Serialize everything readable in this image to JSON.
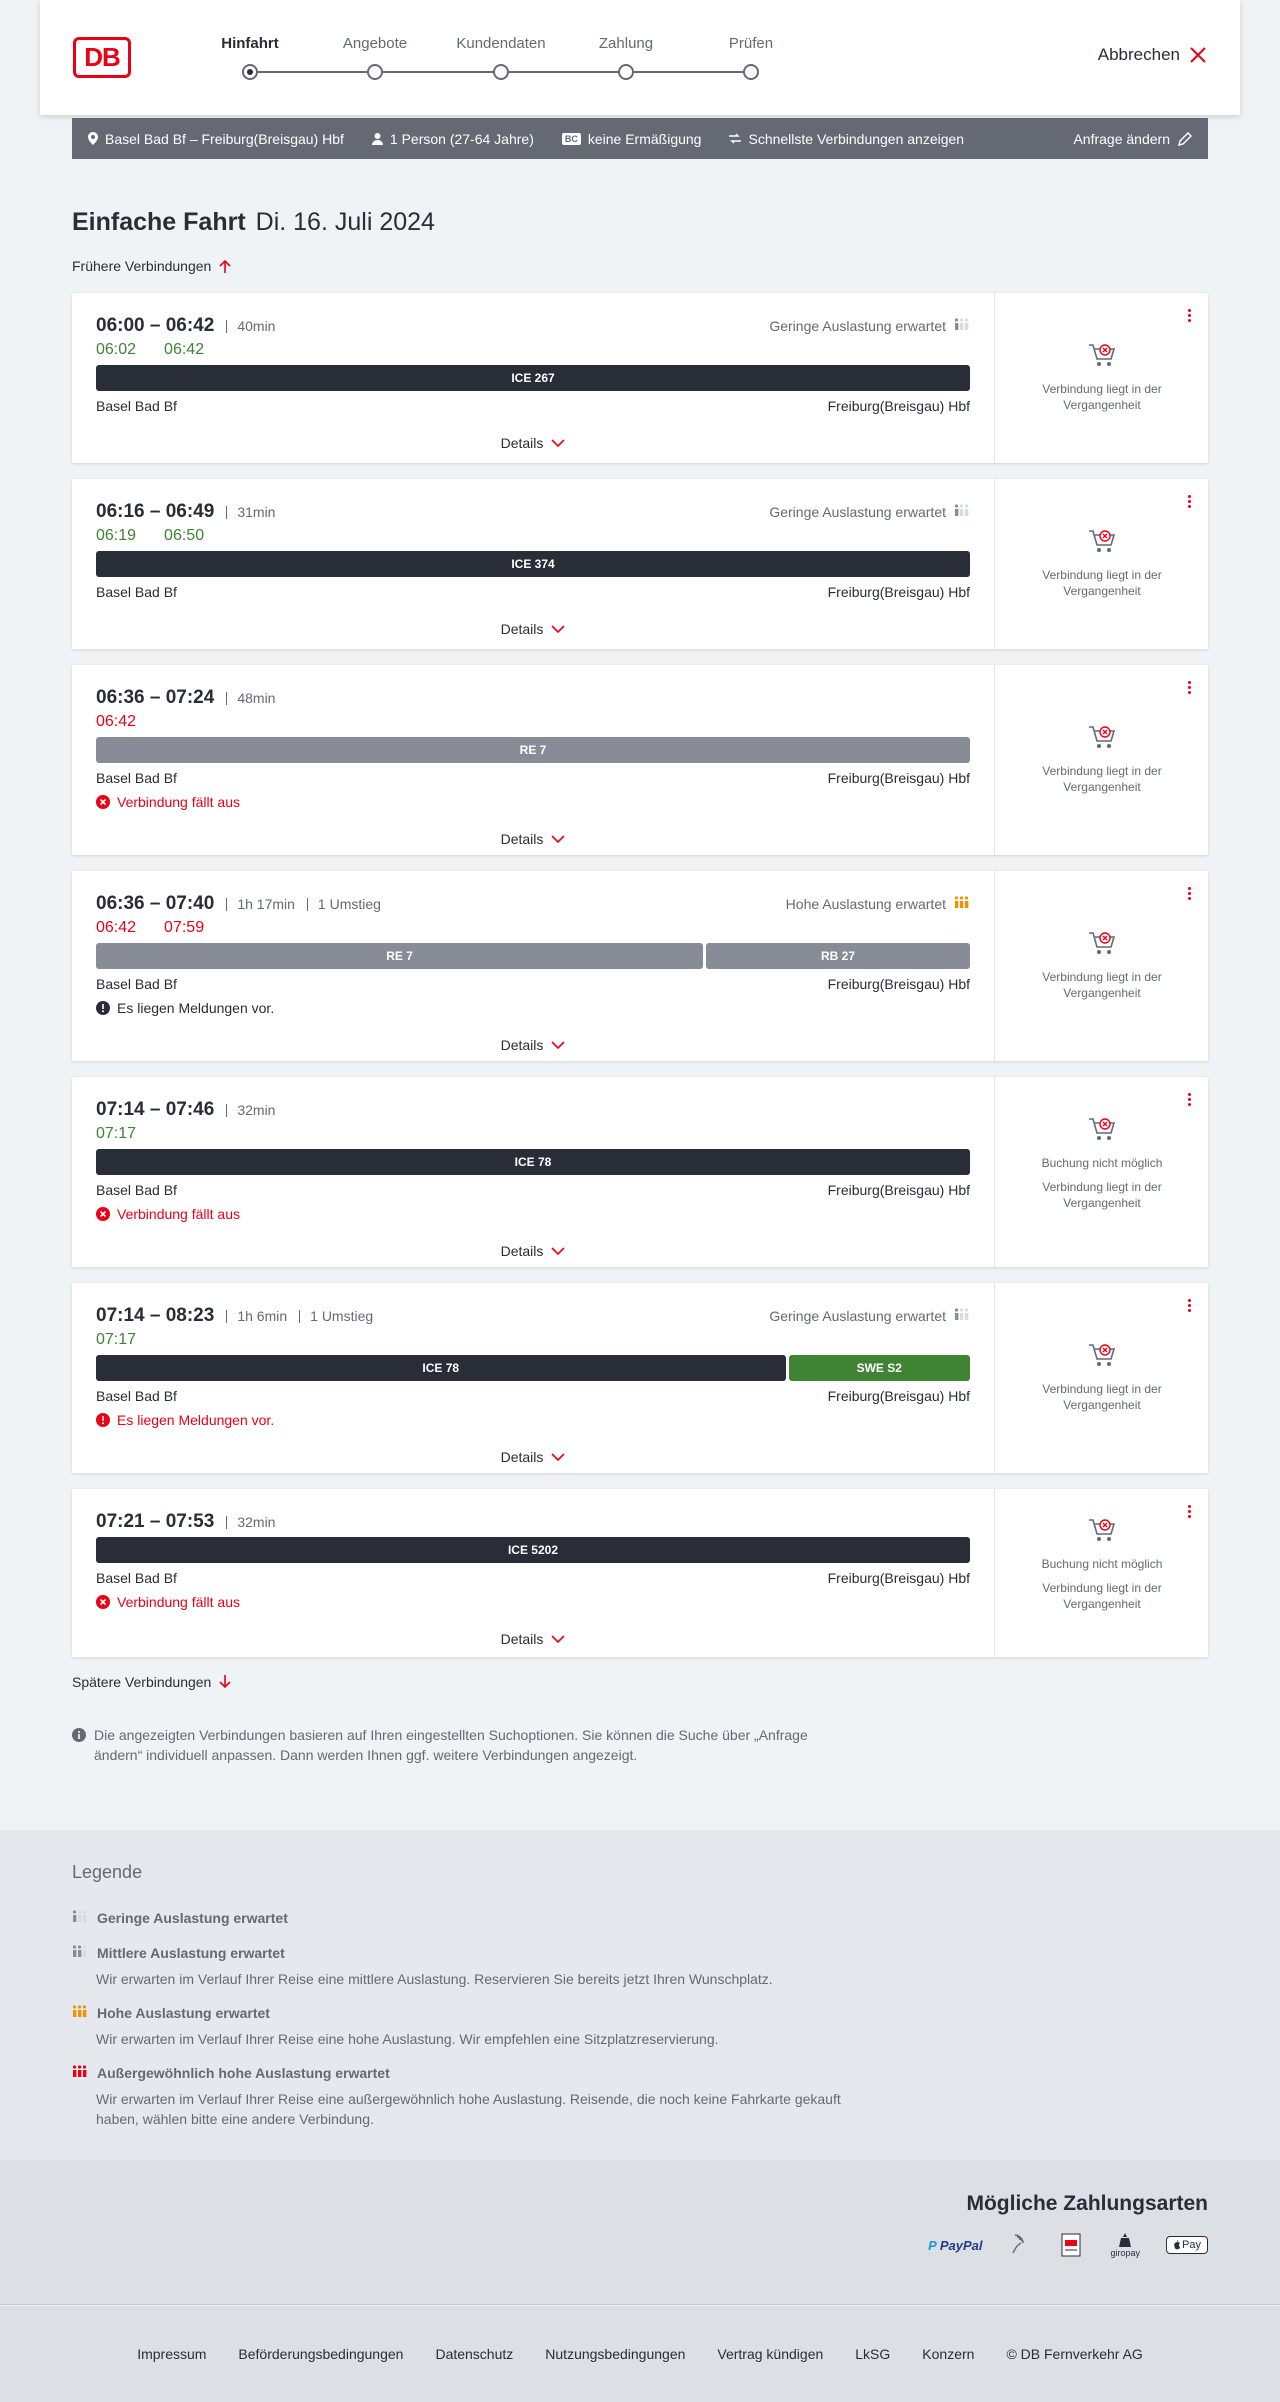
{
  "header": {
    "logo": "DB",
    "steps": [
      "Hinfahrt",
      "Angebote",
      "Kundendaten",
      "Zahlung",
      "Prüfen"
    ],
    "active_step": 0,
    "cancel": "Abbrechen"
  },
  "summary": {
    "route": "Basel Bad Bf – Freiburg(Breisgau) Hbf",
    "passengers": "1 Person (27-64 Jahre)",
    "bahncard_badge": "BC",
    "discount": "keine Ermäßigung",
    "fastest": "Schnellste Verbindungen anzeigen",
    "change": "Anfrage ändern"
  },
  "title": {
    "type": "Einfache Fahrt",
    "date": "Di. 16. Juli 2024"
  },
  "earlier": "Frühere Verbindungen",
  "later": "Spätere Verbindungen",
  "details_label": "Details",
  "connections": [
    {
      "times": "06:00 – 06:42",
      "meta": [
        "40min"
      ],
      "rt": [
        {
          "t": "06:02",
          "c": "green"
        },
        {
          "t": "06:42",
          "c": "green"
        }
      ],
      "occupancy": "Geringe Auslastung erwartet",
      "trains": [
        {
          "name": "ICE 267",
          "style": "dark",
          "flex": 1
        }
      ],
      "from": "Basel Bad Bf",
      "to": "Freiburg(Breisgau) Hbf",
      "message": "",
      "right": [
        "Verbindung liegt in der Vergangenheit"
      ]
    },
    {
      "times": "06:16 – 06:49",
      "meta": [
        "31min"
      ],
      "rt": [
        {
          "t": "06:19",
          "c": "green"
        },
        {
          "t": "06:50",
          "c": "green"
        }
      ],
      "occupancy": "Geringe Auslastung erwartet",
      "trains": [
        {
          "name": "ICE 374",
          "style": "dark",
          "flex": 1
        }
      ],
      "from": "Basel Bad Bf",
      "to": "Freiburg(Breisgau) Hbf",
      "message": "",
      "right": [
        "Verbindung liegt in der Vergangenheit"
      ]
    },
    {
      "times": "06:36 – 07:24",
      "meta": [
        "48min"
      ],
      "rt": [
        {
          "t": "06:42",
          "c": "red"
        }
      ],
      "occupancy": "",
      "trains": [
        {
          "name": "RE 7",
          "style": "grey",
          "flex": 1
        }
      ],
      "from": "Basel Bad Bf",
      "to": "Freiburg(Breisgau) Hbf",
      "message": "Verbindung fällt aus",
      "message_type": "cancel",
      "right": [
        "Verbindung liegt in der Vergangenheit"
      ]
    },
    {
      "times": "06:36 – 07:40",
      "meta": [
        "1h 17min",
        "1 Umstieg"
      ],
      "rt": [
        {
          "t": "06:42",
          "c": "red"
        },
        {
          "t": "07:59",
          "c": "red"
        }
      ],
      "occupancy": "Hohe Auslastung erwartet",
      "trains": [
        {
          "name": "RE 7",
          "style": "grey",
          "flex": 2.3
        },
        {
          "name": "RB 27",
          "style": "grey",
          "flex": 1
        }
      ],
      "from": "Basel Bad Bf",
      "to": "Freiburg(Breisgau) Hbf",
      "message": "Es liegen Meldungen vor.",
      "message_type": "info",
      "right": [
        "Verbindung liegt in der Vergangenheit"
      ]
    },
    {
      "times": "07:14 – 07:46",
      "meta": [
        "32min"
      ],
      "rt": [
        {
          "t": "07:17",
          "c": "green"
        }
      ],
      "occupancy": "",
      "trains": [
        {
          "name": "ICE 78",
          "style": "dark",
          "flex": 1
        }
      ],
      "from": "Basel Bad Bf",
      "to": "Freiburg(Breisgau) Hbf",
      "message": "Verbindung fällt aus",
      "message_type": "cancel",
      "right": [
        "Buchung nicht möglich",
        "Verbindung liegt in der Vergangenheit"
      ]
    },
    {
      "times": "07:14 – 08:23",
      "meta": [
        "1h 6min",
        "1 Umstieg"
      ],
      "rt": [
        {
          "t": "07:17",
          "c": "green"
        }
      ],
      "occupancy": "Geringe Auslastung erwartet",
      "trains": [
        {
          "name": "ICE 78",
          "style": "dark",
          "flex": 3.8
        },
        {
          "name": "SWE S2",
          "style": "green",
          "flex": 1
        }
      ],
      "from": "Basel Bad Bf",
      "to": "Freiburg(Breisgau) Hbf",
      "message": "Es liegen Meldungen vor.",
      "message_type": "warn",
      "right": [
        "Verbindung liegt in der Vergangenheit"
      ]
    },
    {
      "times": "07:21 – 07:53",
      "meta": [
        "32min"
      ],
      "rt": [],
      "occupancy": "",
      "trains": [
        {
          "name": "ICE 5202",
          "style": "dark",
          "flex": 1
        }
      ],
      "from": "Basel Bad Bf",
      "to": "Freiburg(Breisgau) Hbf",
      "message": "Verbindung fällt aus",
      "message_type": "cancel",
      "right": [
        "Buchung nicht möglich",
        "Verbindung liegt in der Vergangenheit"
      ]
    }
  ],
  "info": "Die angezeigten Verbindungen basieren auf Ihren eingestellten Suchoptionen. Sie können die Suche über „Anfrage ändern“ individuell anpassen. Dann werden Ihnen ggf. weitere Verbindungen angezeigt.",
  "legend": {
    "title": "Legende",
    "items": [
      {
        "head": "Geringe Auslastung erwartet",
        "desc": "",
        "level": 1
      },
      {
        "head": "Mittlere Auslastung erwartet",
        "desc": "Wir erwarten im Verlauf Ihrer Reise eine mittlere Auslastung. Reservieren Sie bereits jetzt Ihren Wunschplatz.",
        "level": 2
      },
      {
        "head": "Hohe Auslastung erwartet",
        "desc": "Wir erwarten im Verlauf Ihrer Reise eine hohe Auslastung. Wir empfehlen eine Sitzplatzreservierung.",
        "level": 3
      },
      {
        "head": "Außergewöhnlich hohe Auslastung erwartet",
        "desc": "Wir erwarten im Verlauf Ihrer Reise eine außergewöhnlich hohe Auslastung. Reisende, die noch keine Fahrkarte gekauft haben, wählen bitte eine andere Verbindung.",
        "level": 4
      }
    ]
  },
  "payment": {
    "title": "Mögliche Zahlungsarten",
    "methods": [
      "PayPal",
      "giropay",
      "Pay"
    ]
  },
  "footer": [
    "Impressum",
    "Beförderungsbedingungen",
    "Datenschutz",
    "Nutzungsbedingungen",
    "Vertrag kündigen",
    "LkSG",
    "Konzern",
    "© DB Fernverkehr AG"
  ]
}
